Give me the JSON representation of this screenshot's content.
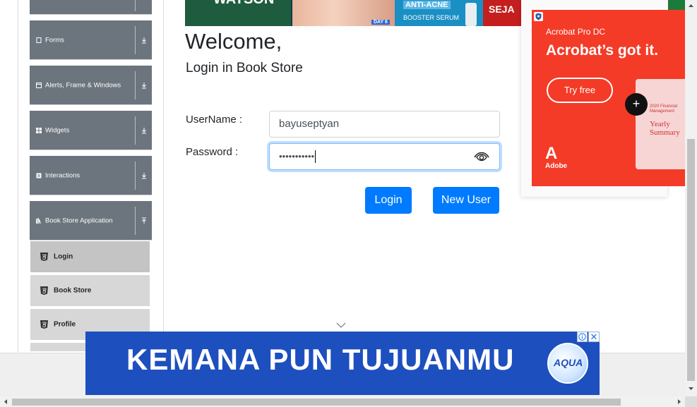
{
  "sidebar": {
    "groups": [
      {
        "label": "Forms",
        "icon": "file-icon",
        "state": "collapsed"
      },
      {
        "label": "Alerts, Frame & Windows",
        "icon": "window-icon",
        "state": "collapsed"
      },
      {
        "label": "Widgets",
        "icon": "grid-icon",
        "state": "collapsed"
      },
      {
        "label": "Interactions",
        "icon": "list-icon",
        "state": "collapsed"
      },
      {
        "label": "Book Store Application",
        "icon": "books-icon",
        "state": "expanded"
      }
    ],
    "items": [
      {
        "label": "Login",
        "icon": "html5-icon",
        "active": true
      },
      {
        "label": "Book Store",
        "icon": "html5-icon",
        "active": false
      },
      {
        "label": "Profile",
        "icon": "html5-icon",
        "active": false
      }
    ]
  },
  "top_banner": {
    "brand": "WATSON",
    "day": "DAY 6",
    "product": "ANTI-ACNE",
    "product_sub": "BOOSTER SERUM",
    "cta": "SEJA"
  },
  "main": {
    "welcome": "Welcome,",
    "subtitle": "Login in Book Store",
    "username_label": "UserName :",
    "username_value": "bayuseptyan",
    "password_label": "Password :",
    "password_value": "•••••••••••",
    "login_button": "Login",
    "new_user_button": "New User"
  },
  "side_ad": {
    "product": "Acrobat Pro DC",
    "headline": "Acrobat’s got it.",
    "cta": "Try free",
    "brand": "Adobe",
    "doc_small": "2020 Financial Management",
    "doc_title": "Yearly Summary"
  },
  "bottom_ad": {
    "text": "KEMANA PUN TUJUANMU",
    "brand": "AQUA"
  },
  "colors": {
    "primary": "#007bff",
    "sidebar_group": "#6c757d",
    "ad_red": "#f43b27",
    "ad_blue": "#1d4fbf"
  }
}
